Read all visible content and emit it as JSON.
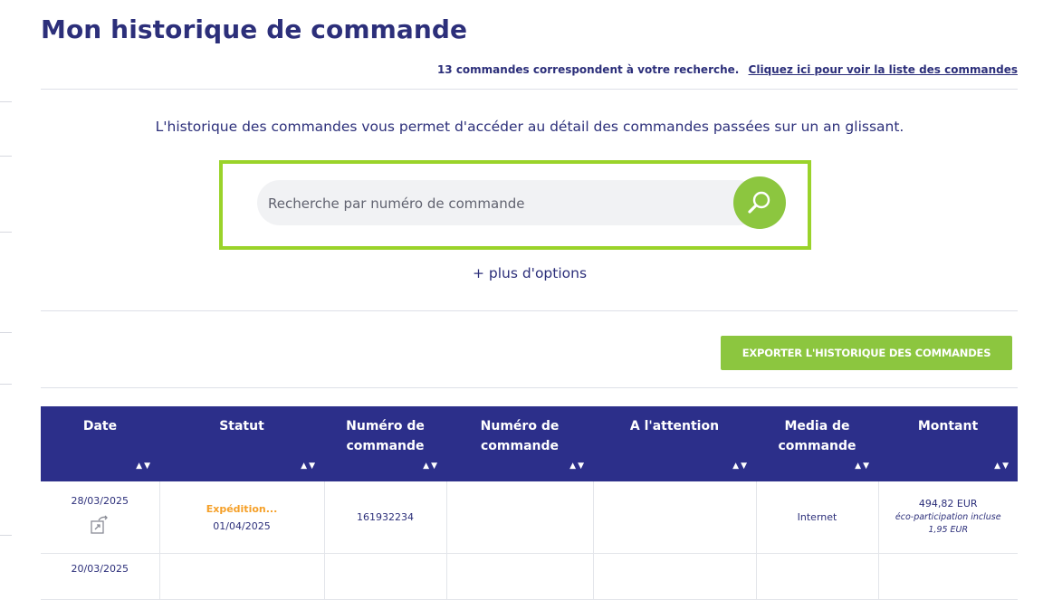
{
  "page": {
    "title": "Mon historique de commande"
  },
  "results": {
    "count_text": "13 commandes correspondent à votre recherche.",
    "list_link": "Cliquez ici pour voir la liste des commandes"
  },
  "intro": "L'historique des commandes vous permet d'accéder au détail des commandes passées sur un an glissant.",
  "search": {
    "placeholder": "Recherche par numéro de commande",
    "value": "",
    "icon": "search-icon"
  },
  "more_options": "+ plus d'options",
  "export_button": "EXPORTER L'HISTORIQUE DES COMMANDES",
  "table": {
    "headers": [
      {
        "label": "Date"
      },
      {
        "label": "Statut"
      },
      {
        "label": "Numéro de commande"
      },
      {
        "label": "Numéro de commande"
      },
      {
        "label": "A l'attention"
      },
      {
        "label": "Media de commande"
      },
      {
        "label": "Montant"
      }
    ],
    "rows": [
      {
        "date": "28/03/2025",
        "status": "Expédition...",
        "status_date": "01/04/2025",
        "order_number": "161932234",
        "order_ref": "",
        "attention": "",
        "media": "Internet",
        "amount": "494,82 EUR",
        "eco_label": "éco-participation incluse",
        "eco_amount": "1,95 EUR"
      },
      {
        "date": "20/03/2025",
        "status": "",
        "status_date": "",
        "order_number": "",
        "order_ref": "",
        "attention": "",
        "media": "",
        "amount": "",
        "eco_label": "",
        "eco_amount": ""
      }
    ]
  },
  "colors": {
    "brand": "#2c2f7a",
    "header_bg": "#2c2f8a",
    "accent_green": "#8cc63f",
    "status_orange": "#f5a029"
  }
}
